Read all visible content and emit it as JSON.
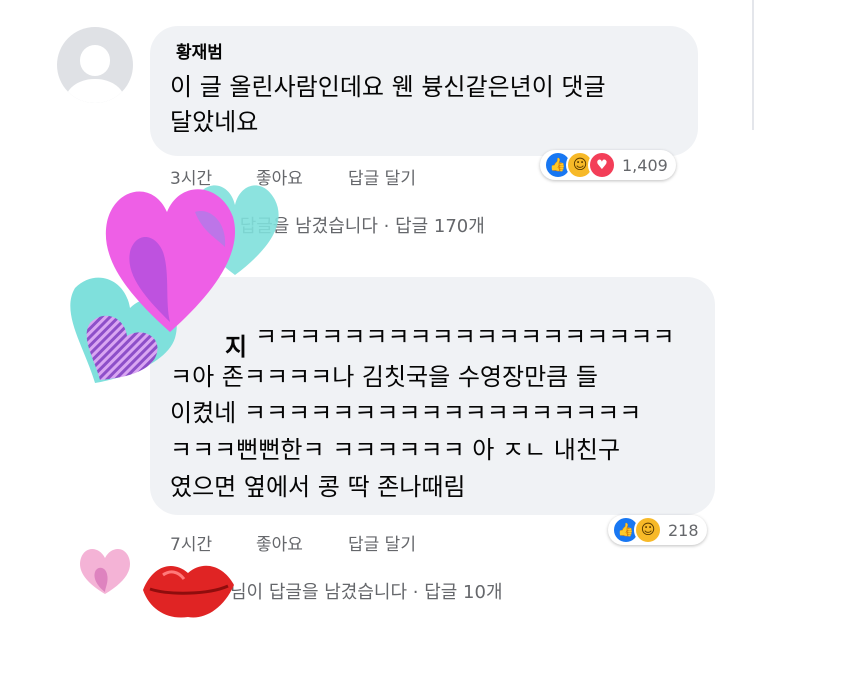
{
  "comments": [
    {
      "author": "황재범",
      "lines": [
        "이 글 올린사람인데요 웬 븅신같은년이 댓글",
        "달았네요"
      ],
      "time": "3시간",
      "like_label": "좋아요",
      "reply_label": "답글 달기",
      "reaction_count": "1,409",
      "reactions": [
        "like",
        "haha",
        "love"
      ],
      "replies_text": "이 답글을 남겼습니다",
      "replies_count": "답글 170개"
    },
    {
      "author_partial": "지",
      "lines": [
        "ㅋㅋㅋㅋㅋㅋㅋㅋㅋㅋㅋㅋㅋㅋㅋㅋㅋㅋㅋ",
        "ㅋ아 존ㅋㅋㅋㅋ나 김칫국을 수영장만큼 들",
        "이켰네 ㅋㅋㅋㅋㅋㅋㅋㅋㅋㅋㅋㅋㅋㅋㅋㅋㅋㅋ",
        "ㅋㅋㅋ뻔뻔한ㅋ ㅋㅋㅋㅋㅋㅋ 아 ㅈㄴ 내친구",
        "였으면 옆에서 콩 딱 존나때림"
      ],
      "time": "7시간",
      "like_label": "좋아요",
      "reply_label": "답글 달기",
      "reaction_count": "218",
      "reactions": [
        "like",
        "haha"
      ],
      "replies_text": "님이 답글을 남겼습니다",
      "replies_count": "답글 10개"
    }
  ],
  "icons": {
    "like": "thumbs-up-icon",
    "haha": "laughing-face-icon",
    "love": "heart-icon"
  },
  "colors": {
    "bubble": "#f0f2f5",
    "meta": "#65676b",
    "like": "#1877f2",
    "haha": "#f7b928",
    "love": "#f33e58",
    "sticker_heart_pink": "#ee5fe6",
    "sticker_heart_purple": "#8d4fc9",
    "sticker_heart_teal": "#7fe0dc",
    "sticker_lips": "#e02424"
  }
}
